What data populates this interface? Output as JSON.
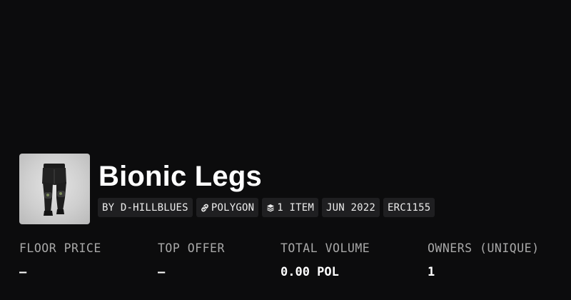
{
  "collection": {
    "name": "Bionic Legs",
    "image_alt": "Bionic Legs thumbnail",
    "tags": {
      "creator": "BY D-HILLBLUES",
      "chain": "POLYGON",
      "items": "1 ITEM",
      "date": "JUN 2022",
      "standard": "ERC1155"
    }
  },
  "stats": {
    "floor_price": {
      "label": "FLOOR PRICE",
      "value": "—"
    },
    "top_offer": {
      "label": "TOP OFFER",
      "value": "—"
    },
    "total_volume": {
      "label": "TOTAL VOLUME",
      "value": "0.00 POL"
    },
    "owners": {
      "label": "OWNERS (UNIQUE)",
      "value": "1"
    }
  },
  "icons": {
    "chain": "link-icon",
    "items": "layers-icon"
  }
}
